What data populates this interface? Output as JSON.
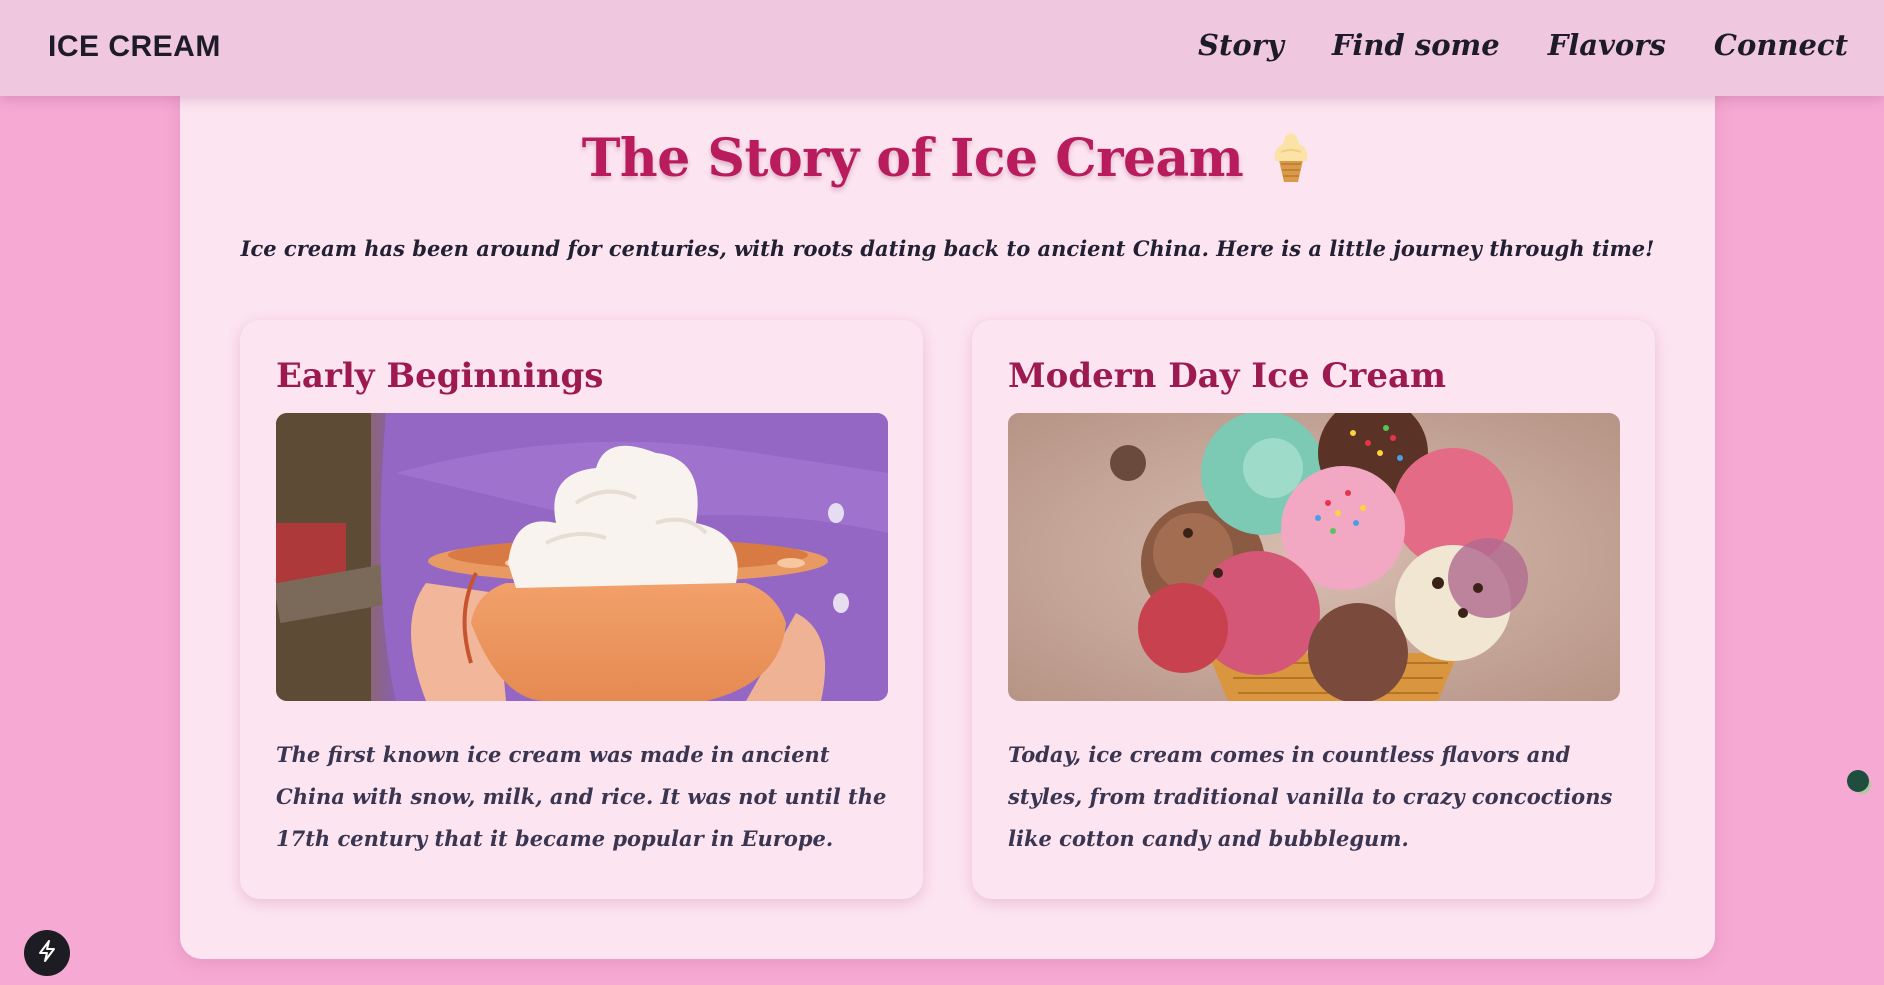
{
  "nav": {
    "logo": "ICE CREAM",
    "links": [
      "Story",
      "Find some",
      "Flavors",
      "Connect"
    ]
  },
  "page": {
    "title": "The Story of Ice Cream",
    "title_icon": "soft-serve-icon",
    "intro": "Ice cream has been around for centuries, with roots dating back to ancient China. Here is a little journey through time!"
  },
  "cards": [
    {
      "title": "Early Beginnings",
      "image": "ancient-ice-cream-bowl-photo",
      "text": "The first known ice cream was made in ancient China with snow, milk, and rice. It was not until the 17th century that it became popular in Europe."
    },
    {
      "title": "Modern Day Ice Cream",
      "image": "ice-cream-scoops-cone-photo",
      "text": "Today, ice cream comes in countless flavors and styles, from traditional vanilla to crazy concoctions like cotton candy and bubblegum."
    }
  ],
  "widgets": {
    "bottom_left_icon": "lightning-bolt-icon",
    "right_edge_icon": "status-dot-icon"
  },
  "colors": {
    "background": "#f6a9d3",
    "nav": "#efc8df",
    "panel": "#fde4f1",
    "title": "#b81c5c",
    "card_title": "#9c1a4f",
    "text": "#3a3550"
  }
}
